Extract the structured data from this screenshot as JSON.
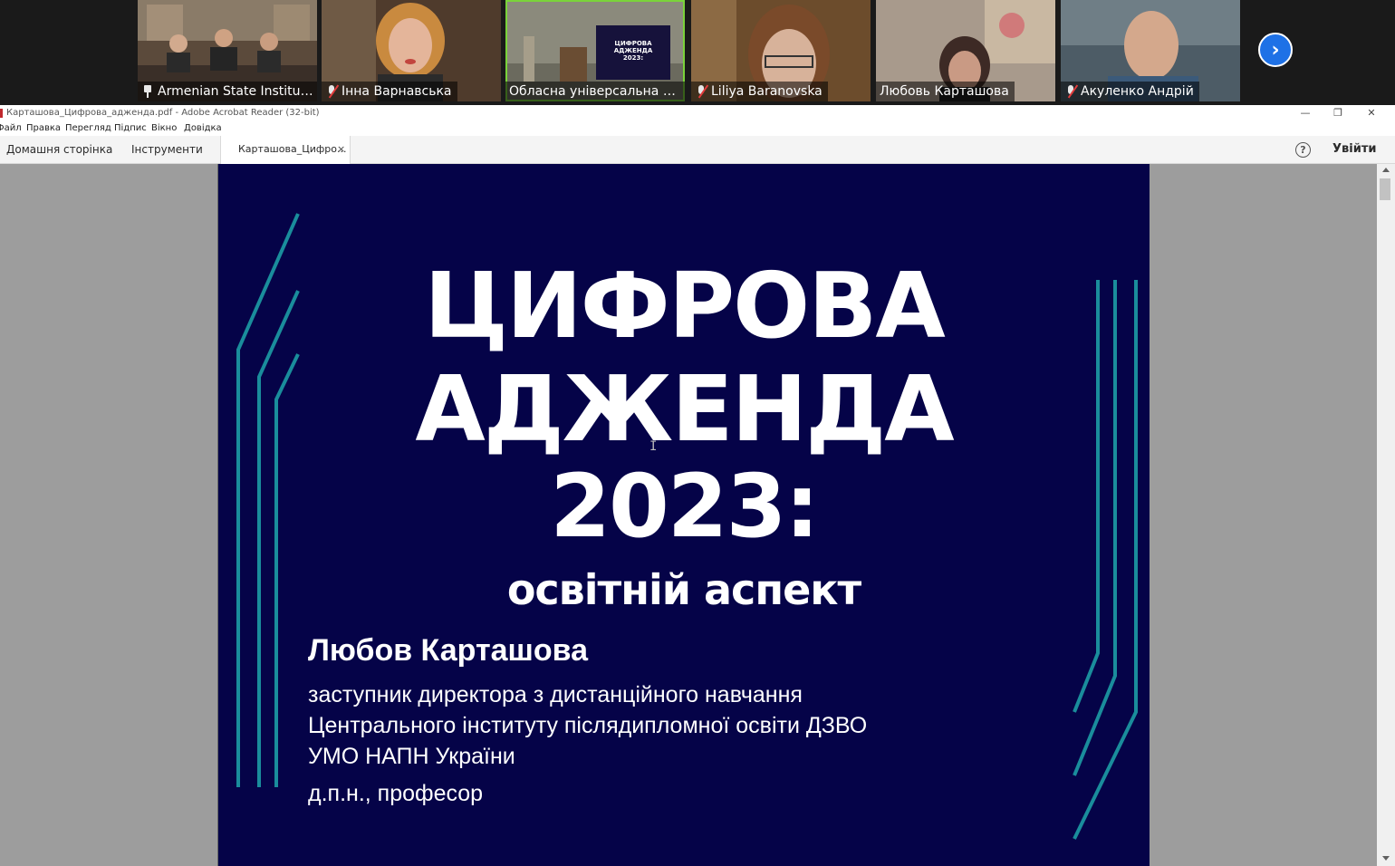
{
  "participants": [
    {
      "name": "Armenian State Institut...",
      "indicator": "pin-icon",
      "tile_color": "#6f5a48"
    },
    {
      "name": "Інна Варнавська",
      "indicator": "mic-muted-icon",
      "tile_color": "#5e4a3a"
    },
    {
      "name": "Обласна універсальна на...",
      "indicator": "",
      "tile_color": "#7a7b6e",
      "active": true
    },
    {
      "name": "Liliya Baranovska",
      "indicator": "mic-muted-icon",
      "tile_color": "#7d5a38"
    },
    {
      "name": "Любовь Карташова",
      "indicator": "",
      "tile_color": "#8b7868"
    },
    {
      "name": "Акуленко Андрій",
      "indicator": "mic-muted-icon",
      "tile_color": "#5d6a73"
    }
  ],
  "window": {
    "title": "Карташова_Цифрова_адженда.pdf - Adobe Acrobat Reader (32-bit)",
    "controls": {
      "minimize": "—",
      "restore": "❐",
      "close": "✕"
    }
  },
  "menu": [
    "Файл",
    "Правка",
    "Перегляд",
    "Підпис",
    "Вікно",
    "Довідка"
  ],
  "tabs": {
    "home": "Домашня сторінка",
    "tools": "Інструменти",
    "document": "Карташова_Цифро...",
    "close": "×"
  },
  "toolbar": {
    "help": "?",
    "signin": "Увійти"
  },
  "slide": {
    "background": "#050348",
    "accent": "#1a8d9c",
    "title_line1": "ЦИФРОВА",
    "title_line2": "АДЖЕНДА",
    "title_line3": "2023:",
    "subtitle": "освітній аспект",
    "author": "Любов Карташова",
    "role_line1": "заступник директора з дистанційного навчання",
    "role_line2": "Центрального інституту післядипломної освіти ДЗВО",
    "role_line3": "УМО НАПН України",
    "degree": "д.п.н., професор"
  }
}
